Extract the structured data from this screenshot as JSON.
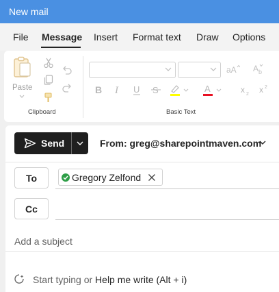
{
  "window": {
    "title": "New mail"
  },
  "tabs": [
    {
      "label": "File"
    },
    {
      "label": "Message"
    },
    {
      "label": "Insert"
    },
    {
      "label": "Format text"
    },
    {
      "label": "Draw"
    },
    {
      "label": "Options"
    }
  ],
  "active_tab": "Message",
  "ribbon": {
    "clipboard": {
      "paste_label": "Paste",
      "group_label": "Clipboard"
    },
    "basic_text": {
      "group_label": "Basic Text",
      "font_name": "",
      "font_size": ""
    }
  },
  "compose": {
    "send_label": "Send",
    "from_label": "From: greg@sharepointmaven.com",
    "to_label": "To",
    "cc_label": "Cc",
    "recipients": [
      {
        "name": "Gregory Zelfond",
        "status": "available"
      }
    ],
    "subject_placeholder": "Add a subject",
    "body_hint_prefix": "Start typing or ",
    "body_hint_link": "Help me write (Alt + i)"
  },
  "colors": {
    "title_bar": "#4a90e2",
    "send_button": "#1f1f1f",
    "presence_available": "#2e9e47",
    "highlight_swatch": "#ffff00",
    "font_color_swatch": "#e81123"
  },
  "icons": [
    "paste-icon",
    "cut-icon",
    "copy-icon",
    "format-painter-icon",
    "undo-icon",
    "redo-icon",
    "bold-icon",
    "italic-icon",
    "underline-icon",
    "strikethrough-icon",
    "highlight-icon",
    "font-color-icon",
    "grow-font-icon",
    "shrink-font-icon",
    "subscript-icon",
    "superscript-icon",
    "send-icon",
    "chevron-down-icon",
    "close-icon",
    "copilot-icon"
  ]
}
